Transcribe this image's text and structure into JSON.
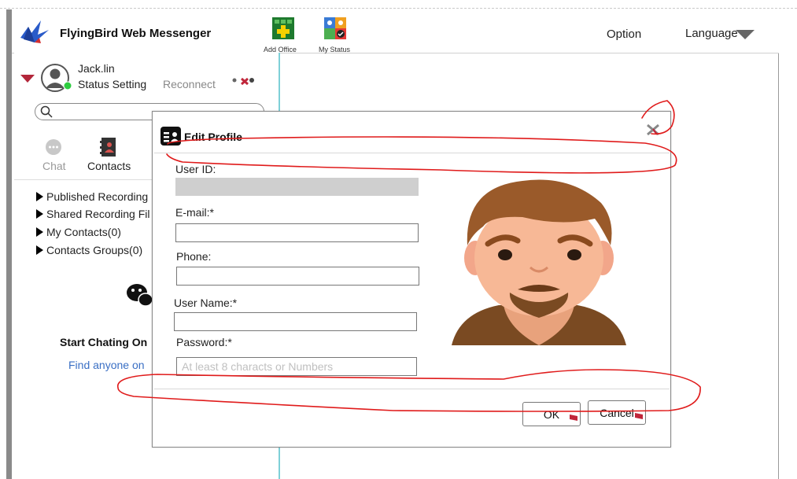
{
  "header": {
    "app_title": "FlyingBird Web Messenger",
    "toolbar": [
      {
        "label": "Add Office",
        "icon": "add-office-icon"
      },
      {
        "label": "My Status",
        "icon": "my-status-icon"
      }
    ],
    "option_label": "Option",
    "language_label": "Language"
  },
  "user": {
    "name": "Jack.lin",
    "status_setting": "Status Setting",
    "reconnect": "Reconnect",
    "status_color": "#2ecc40"
  },
  "search": {
    "placeholder": ""
  },
  "tabs": [
    {
      "label": "Chat",
      "active": false
    },
    {
      "label": "Contacts",
      "active": true
    }
  ],
  "tree": [
    "Published Recording",
    "Shared Recording Fil",
    "My Contacts(0)",
    "Contacts Groups(0)"
  ],
  "empty_state": {
    "title": "Start Chating On",
    "link": "Find anyone  on"
  },
  "dialog": {
    "title": "Edit Profile",
    "fields": {
      "user_id": {
        "label": "User ID:",
        "value": ""
      },
      "email": {
        "label": "E-mail:*",
        "value": ""
      },
      "phone": {
        "label": "Phone:",
        "value": ""
      },
      "user_name": {
        "label": "User Name:*",
        "value": ""
      },
      "password": {
        "label": "Password:*",
        "placeholder": "At least 8 characts or Numbers"
      }
    },
    "ok_label": "OK",
    "cancel_label": "Cancel"
  },
  "colors": {
    "accent_line": "#7fd0d8",
    "link": "#3a6fc4",
    "annotation": "#e01b1b"
  }
}
